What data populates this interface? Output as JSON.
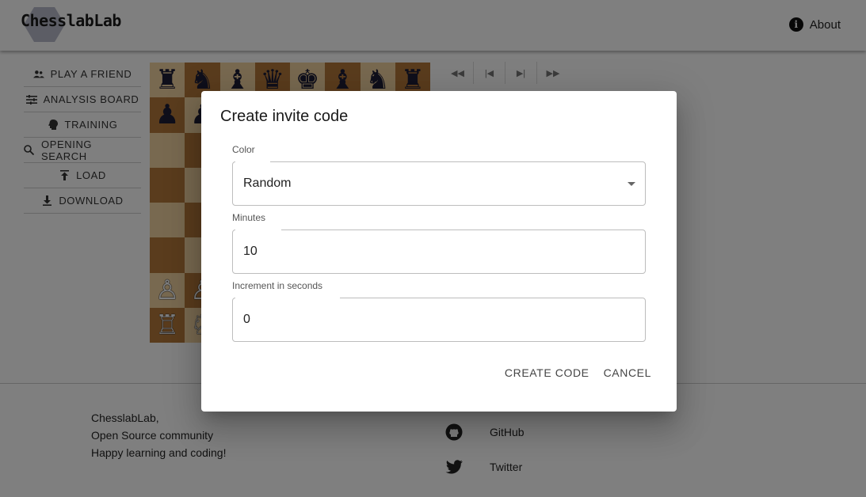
{
  "header": {
    "logo_text": "ChesslabLab",
    "about_label": "About",
    "about_icon": "info-icon"
  },
  "sidebar": {
    "items": [
      {
        "label": "PLAY A FRIEND",
        "icon": "people-icon"
      },
      {
        "label": "ANALYSIS BOARD",
        "icon": "sliders-icon"
      },
      {
        "label": "TRAINING",
        "icon": "brain-icon"
      },
      {
        "label": "OPENING SEARCH",
        "icon": "search-icon"
      },
      {
        "label": "LOAD",
        "icon": "upload-icon"
      },
      {
        "label": "DOWNLOAD",
        "icon": "download-icon"
      }
    ]
  },
  "board": {
    "light_color": "#f0d2a1",
    "dark_color": "#b5793a",
    "rows": [
      [
        "♜",
        "♞",
        "♝",
        "♛",
        "♚",
        "♝",
        "♞",
        "♜"
      ],
      [
        "♟",
        "♟",
        "",
        "",
        "",
        "",
        "",
        ""
      ],
      [
        "",
        "",
        "",
        "",
        "",
        "",
        "",
        ""
      ],
      [
        "",
        "",
        "",
        "",
        "",
        "",
        "",
        ""
      ],
      [
        "",
        "",
        "",
        "",
        "",
        "",
        "",
        ""
      ],
      [
        "",
        "",
        "",
        "",
        "",
        "",
        "",
        ""
      ],
      [
        "♙",
        "♙",
        "",
        "",
        "",
        "",
        "",
        ""
      ],
      [
        "♖",
        "♘",
        "",
        "",
        "",
        "",
        "",
        ""
      ]
    ]
  },
  "move_nav": {
    "buttons": [
      "first-move-icon",
      "prev-move-icon",
      "next-move-icon",
      "last-move-icon"
    ]
  },
  "dialog": {
    "title": "Create invite code",
    "fields": {
      "color": {
        "label": "Color",
        "value": "Random"
      },
      "minutes": {
        "label": "Minutes",
        "value": "10"
      },
      "increment": {
        "label": "Increment in seconds",
        "value": "0"
      }
    },
    "create_label": "CREATE CODE",
    "cancel_label": "CANCEL"
  },
  "footer": {
    "line1": "ChesslabLab,",
    "line2": "Open Source community",
    "line3": "Happy learning and coding!",
    "github_label": "GitHub",
    "twitter_label": "Twitter"
  }
}
